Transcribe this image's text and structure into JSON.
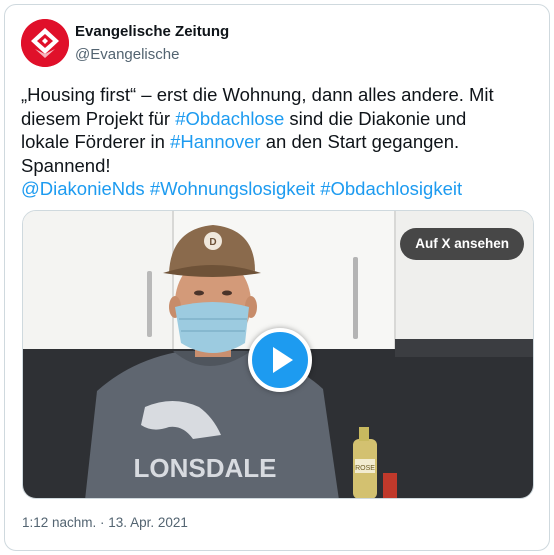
{
  "account": {
    "display_name": "Evangelische Zeitung",
    "handle": "@Evangelische",
    "avatar_icon": "ez-logo-icon",
    "avatar_color": "#e0102a"
  },
  "tweet": {
    "line1_a": "„Housing first“ – erst die Wohnung, dann alles andere. Mit",
    "line2_a": "diesem Projekt für ",
    "hashtag_1": "#Obdachlose",
    "line2_b": " sind die Diakonie und",
    "line3_a": "lokale Förderer in ",
    "hashtag_2": "#Hannover",
    "line3_b": " an den Start gegangen.",
    "line4": "Spannend!",
    "mention": "@DiakonieNds",
    "hashtag_3": "#Wohnungslosigkeit",
    "hashtag_4": "#Obdachlosigkeit",
    "link_color": "#1d9bf0"
  },
  "media": {
    "watch_button_label": "Auf X ansehen",
    "play_icon": "play-icon",
    "play_color": "#1d9bf0",
    "cap_text": "D",
    "sweater_text": "LONSDALE",
    "bottle_text": "ROSE"
  },
  "meta": {
    "timestamp": "1:12 nachm. · 13. Apr. 2021"
  }
}
